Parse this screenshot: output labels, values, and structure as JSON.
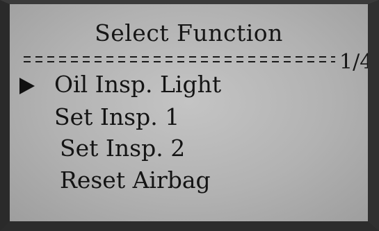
{
  "screen": {
    "title": "Select Function",
    "page_indicator": "1/4",
    "selected_index": 0,
    "menu": [
      {
        "label": "Oil Insp. Light"
      },
      {
        "label": "Set Insp. 1"
      },
      {
        "label": "Set Insp. 2"
      },
      {
        "label": "Reset Airbag"
      }
    ],
    "cursor_icon": "triangle-right-icon"
  }
}
